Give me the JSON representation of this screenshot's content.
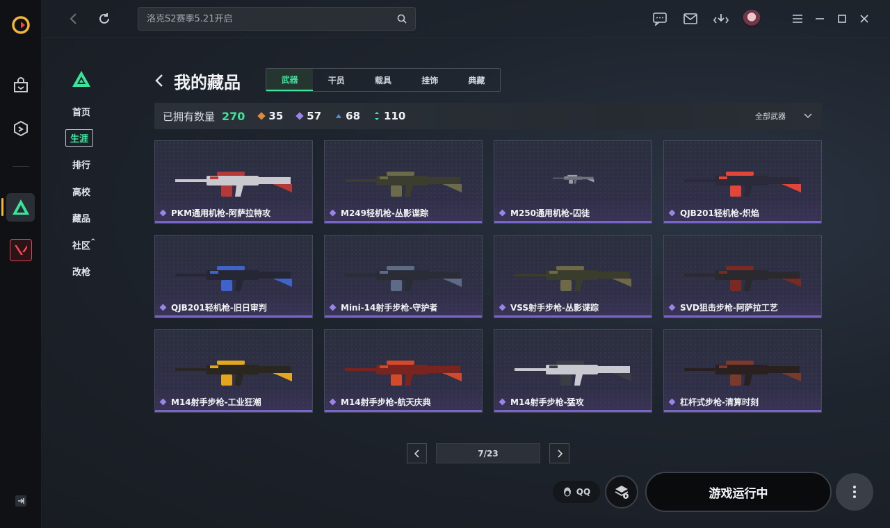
{
  "search": {
    "placeholder": "洛克S2赛季5.21开启"
  },
  "sidebar": {
    "items": [
      {
        "label": "首页"
      },
      {
        "label": "生涯"
      },
      {
        "label": "排行"
      },
      {
        "label": "高校"
      },
      {
        "label": "藏品"
      },
      {
        "label": "社区"
      },
      {
        "label": "改枪"
      }
    ],
    "active_index": 1
  },
  "page": {
    "title": "我的藏品"
  },
  "tabs": [
    {
      "label": "武器"
    },
    {
      "label": "干员"
    },
    {
      "label": "载具"
    },
    {
      "label": "挂饰"
    },
    {
      "label": "典藏"
    }
  ],
  "stats": {
    "owned_label": "已拥有数量",
    "owned_total": "270",
    "rarities": [
      {
        "count": "35",
        "color": "#e08a3a"
      },
      {
        "count": "57",
        "color": "#9b84e8"
      },
      {
        "count": "68",
        "color": "#4a90d9"
      },
      {
        "count": "110",
        "color": "#3be39b"
      }
    ],
    "filter_label": "全部武器"
  },
  "items": [
    {
      "name": "PKM通用机枪-阿萨拉特攻",
      "gun_color": "#c9c9cf",
      "accent": "#b43a3a"
    },
    {
      "name": "M249轻机枪-丛影谍踪",
      "gun_color": "#3b3d2f",
      "accent": "#6b6a4a"
    },
    {
      "name": "M250通用机枪-囚徒",
      "gun_color": "#6c707a",
      "accent": "#9aa0ac"
    },
    {
      "name": "QJB201轻机枪-炽焰",
      "gun_color": "#2a2a3a",
      "accent": "#e2453a"
    },
    {
      "name": "QJB201轻机枪-旧日审判",
      "gun_color": "#252834",
      "accent": "#3f63c8"
    },
    {
      "name": "Mini-14射手步枪-守护者",
      "gun_color": "#2a2d36",
      "accent": "#5d6b86"
    },
    {
      "name": "VSS射手步枪-丛影谍踪",
      "gun_color": "#3a3d2c",
      "accent": "#6e6a48"
    },
    {
      "name": "SVD狙击步枪-阿萨拉工艺",
      "gun_color": "#2a2a2e",
      "accent": "#7a2a22"
    },
    {
      "name": "M14射手步枪-工业狂潮",
      "gun_color": "#2a2620",
      "accent": "#e2a61f"
    },
    {
      "name": "M14射手步枪-航天庆典",
      "gun_color": "#7a2420",
      "accent": "#d24a2a"
    },
    {
      "name": "M14射手步枪-猛攻",
      "gun_color": "#c7cad0",
      "accent": "#3a3d44"
    },
    {
      "name": "杠杆式步枪-清算时刻",
      "gun_color": "#2a2020",
      "accent": "#7a3a2a"
    }
  ],
  "pagination": {
    "text": "7/23"
  },
  "bottom": {
    "qq_label": "QQ",
    "run_label": "游戏运行中"
  },
  "colors": {
    "accent": "#3be39b",
    "purple": "#9b84e8"
  }
}
